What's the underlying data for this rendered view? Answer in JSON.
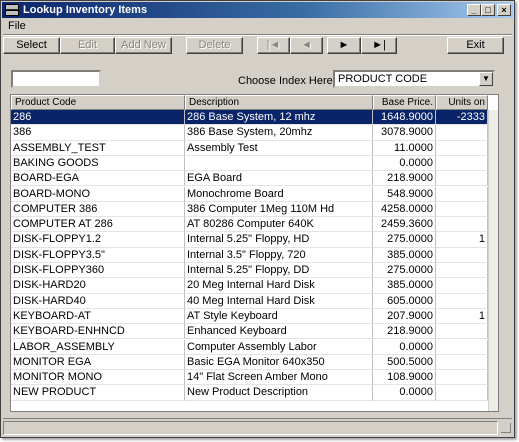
{
  "window": {
    "title": "Lookup Inventory Items",
    "icon": "app-icon"
  },
  "menu": {
    "file": "File"
  },
  "toolbar": {
    "select": "Select",
    "edit": "Edit",
    "add_new": "Add New",
    "delete": "Delete",
    "first": "|◄",
    "prev": "◄",
    "next": "►",
    "last": "►|",
    "exit": "Exit"
  },
  "search": {
    "value": "",
    "placeholder": ""
  },
  "index": {
    "label": "Choose Index Here:",
    "selected": "PRODUCT CODE"
  },
  "grid": {
    "columns": [
      "Product Code",
      "Description",
      "Base Price.",
      "Units on"
    ],
    "rows": [
      {
        "code": "286",
        "desc": "286 Base System, 12 mhz",
        "price": "1648.9000",
        "units": "-2333"
      },
      {
        "code": "386",
        "desc": "386 Base System, 20mhz",
        "price": "3078.9000",
        "units": ""
      },
      {
        "code": "ASSEMBLY_TEST",
        "desc": "Assembly Test",
        "price": "11.0000",
        "units": ""
      },
      {
        "code": "BAKING GOODS",
        "desc": "",
        "price": "0.0000",
        "units": ""
      },
      {
        "code": "BOARD-EGA",
        "desc": "EGA Board",
        "price": "218.9000",
        "units": ""
      },
      {
        "code": "BOARD-MONO",
        "desc": "Monochrome Board",
        "price": "548.9000",
        "units": ""
      },
      {
        "code": "COMPUTER 386",
        "desc": "386 Computer 1Meg 110M Hd",
        "price": "4258.0000",
        "units": ""
      },
      {
        "code": "COMPUTER AT 286",
        "desc": "AT 80286 Computer 640K",
        "price": "2459.3600",
        "units": ""
      },
      {
        "code": "DISK-FLOPPY1.2",
        "desc": "Internal 5.25\" Floppy, HD",
        "price": "275.0000",
        "units": "1"
      },
      {
        "code": "DISK-FLOPPY3.5\"",
        "desc": "Internal 3.5\" Floppy, 720",
        "price": "385.0000",
        "units": ""
      },
      {
        "code": "DISK-FLOPPY360",
        "desc": "Internal 5.25\" Floppy, DD",
        "price": "275.0000",
        "units": ""
      },
      {
        "code": "DISK-HARD20",
        "desc": "20 Meg Internal Hard Disk",
        "price": "385.0000",
        "units": ""
      },
      {
        "code": "DISK-HARD40",
        "desc": "40 Meg Internal Hard Disk",
        "price": "605.0000",
        "units": ""
      },
      {
        "code": "KEYBOARD-AT",
        "desc": "AT Style Keyboard",
        "price": "207.9000",
        "units": "1"
      },
      {
        "code": "KEYBOARD-ENHNCD",
        "desc": "Enhanced Keyboard",
        "price": "218.9000",
        "units": ""
      },
      {
        "code": "LABOR_ASSEMBLY",
        "desc": "Computer Assembly Labor",
        "price": "0.0000",
        "units": ""
      },
      {
        "code": "MONITOR EGA",
        "desc": "Basic EGA Monitor 640x350",
        "price": "500.5000",
        "units": ""
      },
      {
        "code": "MONITOR MONO",
        "desc": "14\" Flat Screen Amber Mono",
        "price": "108.9000",
        "units": ""
      },
      {
        "code": "NEW PRODUCT",
        "desc": "New Product Description",
        "price": "0.0000",
        "units": ""
      }
    ]
  },
  "colors": {
    "titlebar": "#0a246a",
    "selection": "#0a246a",
    "face": "#d4d0c8"
  }
}
